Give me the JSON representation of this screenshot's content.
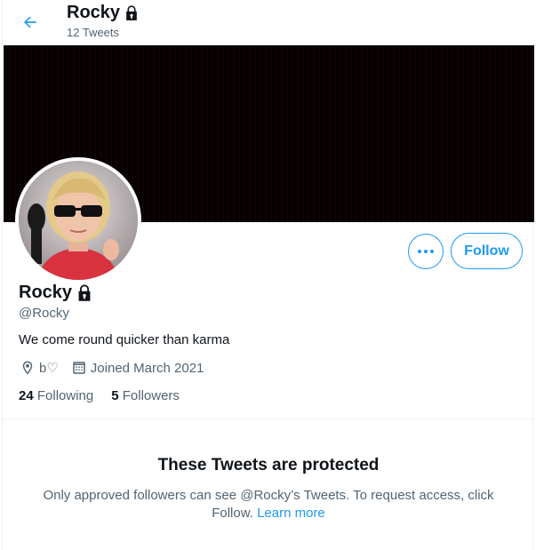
{
  "header": {
    "name": "Rocky",
    "tweet_count": "12 Tweets"
  },
  "profile": {
    "name": "Rocky",
    "handle": "@Rocky",
    "bio": "We come round quicker than karma",
    "location": "b♡",
    "joined": "Joined March 2021",
    "following_count": "24",
    "following_label": "Following",
    "followers_count": "5",
    "followers_label": "Followers"
  },
  "actions": {
    "follow_label": "Follow"
  },
  "protected": {
    "title": "These Tweets are protected",
    "text": "Only approved followers can see @Rocky’s Tweets. To request access, click Follow.",
    "learn_more": "Learn more"
  },
  "colors": {
    "accent": "#1d9bf0",
    "text": "#0f1419",
    "secondary": "#536471",
    "banner": "#050101"
  }
}
